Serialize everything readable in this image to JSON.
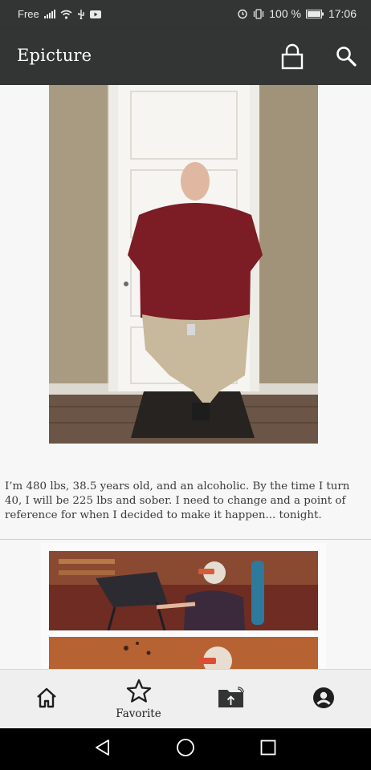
{
  "status_bar": {
    "carrier": "Free",
    "battery_percent": "100 %",
    "time": "17:06",
    "icons": [
      "signal-icon",
      "wifi-icon",
      "usb-icon",
      "video-icon",
      "alarm-icon",
      "vibrate-icon",
      "battery-icon"
    ]
  },
  "app_bar": {
    "title": "Epicture",
    "actions": [
      "lock-icon",
      "search-icon"
    ]
  },
  "feed": {
    "posts": [
      {
        "caption": "I’m 480 lbs, 38.5 years old, and an alcoholic. By the time I turn 40, I will be 225 lbs and sober. I need to change and a point of reference for when I decided to make it happen... tonight."
      },
      {
        "caption": ""
      }
    ]
  },
  "bottom_nav": {
    "items": [
      {
        "id": "home",
        "label": "",
        "icon": "home-icon"
      },
      {
        "id": "favorite",
        "label": "Favorite",
        "icon": "star-icon"
      },
      {
        "id": "upload",
        "label": "",
        "icon": "folder-upload-icon"
      },
      {
        "id": "account",
        "label": "",
        "icon": "account-icon"
      }
    ]
  },
  "system_nav": {
    "buttons": [
      "back-icon",
      "home-circle-icon",
      "recents-icon"
    ]
  },
  "colors": {
    "bar": "#333434",
    "background": "#f7f7f7",
    "nav_background": "#efefef",
    "caption_text": "#3a3a3a"
  }
}
